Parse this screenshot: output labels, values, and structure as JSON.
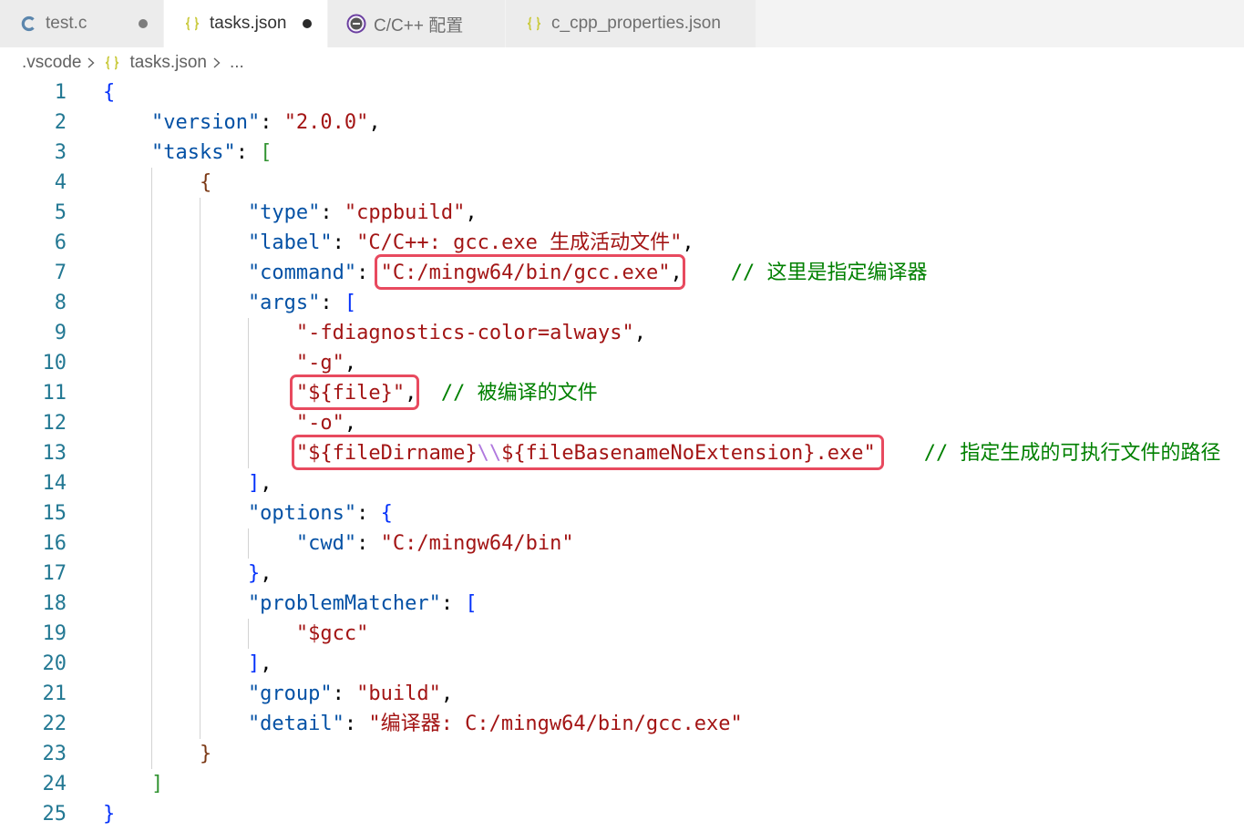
{
  "tabs": [
    {
      "label": "test.c",
      "icon": "c-file-icon",
      "dirty": true,
      "active": false
    },
    {
      "label": "tasks.json",
      "icon": "json-file-icon",
      "dirty": true,
      "active": true
    },
    {
      "label": "C/C++ 配置",
      "icon": "cpp-extension-icon",
      "dirty": false,
      "active": false
    },
    {
      "label": "c_cpp_properties.json",
      "icon": "json-file-icon",
      "dirty": false,
      "active": false
    }
  ],
  "breadcrumb": {
    "folder": ".vscode",
    "file": "tasks.json",
    "file_icon": "json-file-icon",
    "symbol": "..."
  },
  "colors": {
    "line_number": "#237893",
    "indent_guide": "#d3d3d3",
    "highlight_box": "#e84a5f",
    "json_icon": "#cbcb41",
    "c_icon": "#5b86ad",
    "cpp_icon_ring": "#6b3fa0"
  },
  "editor": {
    "lines": [
      {
        "n": "1",
        "tokens": [
          [
            "{",
            "#0431fa"
          ]
        ]
      },
      {
        "n": "2",
        "tokens": [
          [
            "    \"version\"",
            "#0451a5"
          ],
          [
            ": ",
            "#000000"
          ],
          [
            "\"2.0.0\"",
            "#a31515"
          ],
          [
            ",",
            "#000000"
          ]
        ]
      },
      {
        "n": "3",
        "tokens": [
          [
            "    \"tasks\"",
            "#0451a5"
          ],
          [
            ": ",
            "#000000"
          ],
          [
            "[",
            "#319331"
          ]
        ]
      },
      {
        "n": "4",
        "tokens": [
          [
            "        {",
            "#7b3814"
          ]
        ]
      },
      {
        "n": "5",
        "tokens": [
          [
            "            \"type\"",
            "#0451a5"
          ],
          [
            ": ",
            "#000000"
          ],
          [
            "\"cppbuild\"",
            "#a31515"
          ],
          [
            ",",
            "#000000"
          ]
        ]
      },
      {
        "n": "6",
        "tokens": [
          [
            "            \"label\"",
            "#0451a5"
          ],
          [
            ": ",
            "#000000"
          ],
          [
            "\"C/C++: gcc.exe 生成活动文件\"",
            "#a31515"
          ],
          [
            ",",
            "#000000"
          ]
        ]
      },
      {
        "n": "7",
        "tokens": [
          [
            "            \"command\"",
            "#0451a5"
          ],
          [
            ": ",
            "#000000"
          ],
          {
            "box": [
              [
                "\"C:/mingw64/bin/gcc.exe\"",
                "#a31515"
              ],
              [
                ",",
                "#000000"
              ]
            ]
          },
          [
            "    // 这里是指定编译器",
            "#008000"
          ]
        ]
      },
      {
        "n": "8",
        "tokens": [
          [
            "            \"args\"",
            "#0451a5"
          ],
          [
            ": ",
            "#000000"
          ],
          [
            "[",
            "#0431fa"
          ]
        ]
      },
      {
        "n": "9",
        "tokens": [
          [
            "                \"-fdiagnostics-color=always\"",
            "#a31515"
          ],
          [
            ",",
            "#000000"
          ]
        ]
      },
      {
        "n": "10",
        "tokens": [
          [
            "                \"-g\"",
            "#a31515"
          ],
          [
            ",",
            "#000000"
          ]
        ]
      },
      {
        "n": "11",
        "tokens": [
          [
            "                ",
            "#000000"
          ],
          {
            "box": [
              [
                "\"${file}\"",
                "#a31515"
              ],
              [
                ",",
                "#000000"
              ]
            ]
          },
          [
            "  // 被编译的文件",
            "#008000"
          ]
        ]
      },
      {
        "n": "12",
        "tokens": [
          [
            "                \"-o\"",
            "#a31515"
          ],
          [
            ",",
            "#000000"
          ]
        ]
      },
      {
        "n": "13",
        "tokens": [
          [
            "                ",
            "#000000"
          ],
          {
            "box": [
              [
                "\"${fileDirname}",
                "#a31515"
              ],
              [
                "\\\\",
                "#b078de"
              ],
              [
                "${fileBasenameNoExtension}.exe\"",
                "#a31515"
              ]
            ]
          },
          [
            "    // 指定生成的可执行文件的路径",
            "#008000"
          ]
        ]
      },
      {
        "n": "14",
        "tokens": [
          [
            "            ]",
            "#0431fa"
          ],
          [
            ",",
            "#000000"
          ]
        ]
      },
      {
        "n": "15",
        "tokens": [
          [
            "            \"options\"",
            "#0451a5"
          ],
          [
            ": ",
            "#000000"
          ],
          [
            "{",
            "#0431fa"
          ]
        ]
      },
      {
        "n": "16",
        "tokens": [
          [
            "                \"cwd\"",
            "#0451a5"
          ],
          [
            ": ",
            "#000000"
          ],
          [
            "\"C:/mingw64/bin\"",
            "#a31515"
          ]
        ]
      },
      {
        "n": "17",
        "tokens": [
          [
            "            }",
            "#0431fa"
          ],
          [
            ",",
            "#000000"
          ]
        ]
      },
      {
        "n": "18",
        "tokens": [
          [
            "            \"problemMatcher\"",
            "#0451a5"
          ],
          [
            ": ",
            "#000000"
          ],
          [
            "[",
            "#0431fa"
          ]
        ]
      },
      {
        "n": "19",
        "tokens": [
          [
            "                \"$gcc\"",
            "#a31515"
          ]
        ]
      },
      {
        "n": "20",
        "tokens": [
          [
            "            ]",
            "#0431fa"
          ],
          [
            ",",
            "#000000"
          ]
        ]
      },
      {
        "n": "21",
        "tokens": [
          [
            "            \"group\"",
            "#0451a5"
          ],
          [
            ": ",
            "#000000"
          ],
          [
            "\"build\"",
            "#a31515"
          ],
          [
            ",",
            "#000000"
          ]
        ]
      },
      {
        "n": "22",
        "tokens": [
          [
            "            \"detail\"",
            "#0451a5"
          ],
          [
            ": ",
            "#000000"
          ],
          [
            "\"编译器: C:/mingw64/bin/gcc.exe\"",
            "#a31515"
          ]
        ]
      },
      {
        "n": "23",
        "tokens": [
          [
            "        }",
            "#7b3814"
          ]
        ]
      },
      {
        "n": "24",
        "tokens": [
          [
            "    ]",
            "#319331"
          ]
        ]
      },
      {
        "n": "25",
        "tokens": [
          [
            "}",
            "#0431fa"
          ]
        ]
      }
    ]
  }
}
